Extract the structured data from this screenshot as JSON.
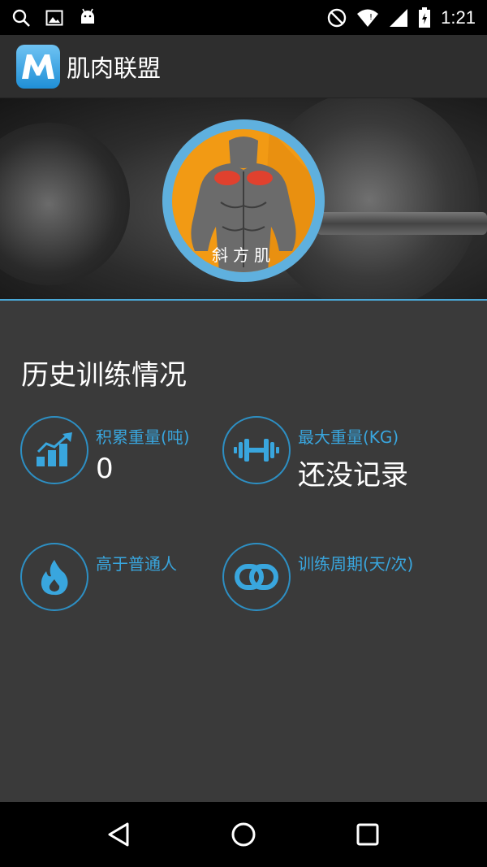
{
  "status_bar": {
    "time": "1:21",
    "left_icons": [
      "search-icon",
      "image-icon",
      "android-icon"
    ],
    "right_icons": [
      "do-not-disturb-icon",
      "wifi-icon",
      "signal-icon",
      "battery-icon"
    ]
  },
  "app_bar": {
    "title": "肌肉联盟",
    "logo_letter": "M"
  },
  "hero": {
    "muscle_name": "斜方肌"
  },
  "history": {
    "title": "历史训练情况",
    "stats": [
      {
        "label": "积累重量(吨)",
        "value": "0",
        "icon": "growth-chart-icon"
      },
      {
        "label": "最大重量(KG)",
        "value": "还没记录",
        "icon": "dumbbell-icon"
      },
      {
        "label": "高于普通人",
        "value": "",
        "icon": "flame-icon"
      },
      {
        "label": "训练周期(天/次)",
        "value": "",
        "icon": "linked-rings-icon"
      }
    ]
  },
  "colors": {
    "accent": "#39a6de",
    "badge_orange": "#f29a14",
    "badge_blue": "#5fb0de",
    "background": "#3a3a3a"
  },
  "nav_bar": {
    "buttons": [
      "back-icon",
      "home-icon",
      "recents-icon"
    ]
  }
}
